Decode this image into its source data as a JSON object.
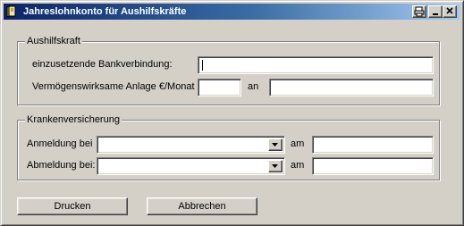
{
  "window": {
    "title": "Jahreslohnkonto für Aushilfskräfte",
    "title_bar_color": "#0a246a",
    "face_color": "#d4d0c8"
  },
  "title_buttons": [
    {
      "icon": "printer-icon"
    },
    {
      "icon": "minimize-icon"
    },
    {
      "icon": "maximize-icon"
    },
    {
      "icon": "close-icon"
    }
  ],
  "aushilfskraft": {
    "title": "Aushilfskraft",
    "bank_label": "einzusetzende Bankverbindung:",
    "bank_value": "",
    "vwl_label": "Vermögenswirksame Anlage €/Monat",
    "vwl_amount_value": "",
    "an_label": "an",
    "an_value": ""
  },
  "krankenversicherung": {
    "title": "Krankenversicherung",
    "anmeldung_label": "Anmeldung bei",
    "anmeldung_selected": "",
    "anmeldung_am_label": "am",
    "anmeldung_date_value": "",
    "abmeldung_label": "Abmeldung bei:",
    "abmeldung_selected": "",
    "abmeldung_am_label": "am",
    "abmeldung_date_value": ""
  },
  "buttons": {
    "print_label": "Drucken",
    "cancel_label": "Abbrechen"
  }
}
